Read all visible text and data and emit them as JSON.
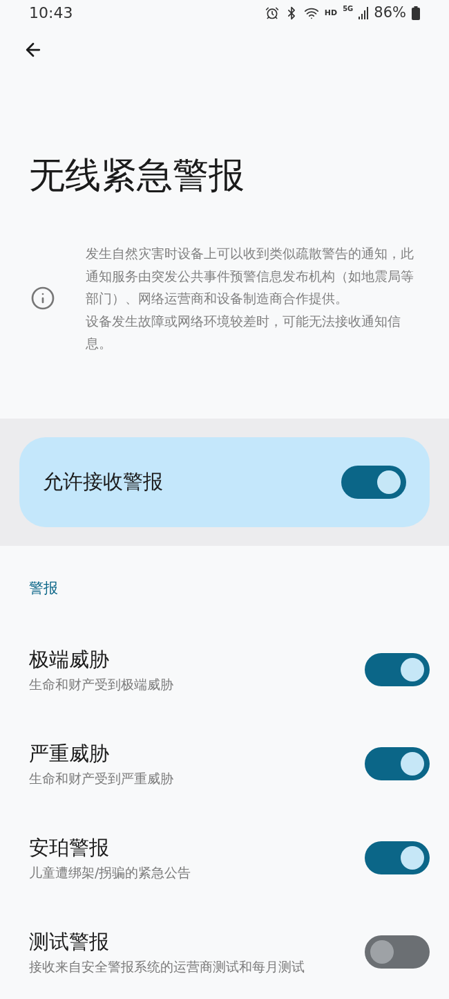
{
  "status_bar": {
    "time": "10:43",
    "network_hd": "HD",
    "network_type": "5G",
    "battery": "86%"
  },
  "title": "无线紧急警报",
  "info": [
    "发生自然灾害时设备上可以收到类似疏散警告的通知，此通知服务由突发公共事件预警信息发布机构（如地震局等部门）、网络运营商和设备制造商合作提供。",
    "设备发生故障或网络环境较差时，可能无法接收通知信息。"
  ],
  "master": {
    "label": "允许接收警报",
    "on": true
  },
  "section": "警报",
  "items": [
    {
      "title": "极端威胁",
      "subtitle": "生命和财产受到极端威胁",
      "on": true
    },
    {
      "title": "严重威胁",
      "subtitle": "生命和财产受到严重威胁",
      "on": true
    },
    {
      "title": "安珀警报",
      "subtitle": "儿童遭绑架/拐骗的紧急公告",
      "on": true
    },
    {
      "title": "测试警报",
      "subtitle": "接收来自安全警报系统的运营商测试和每月测试",
      "on": false
    }
  ]
}
